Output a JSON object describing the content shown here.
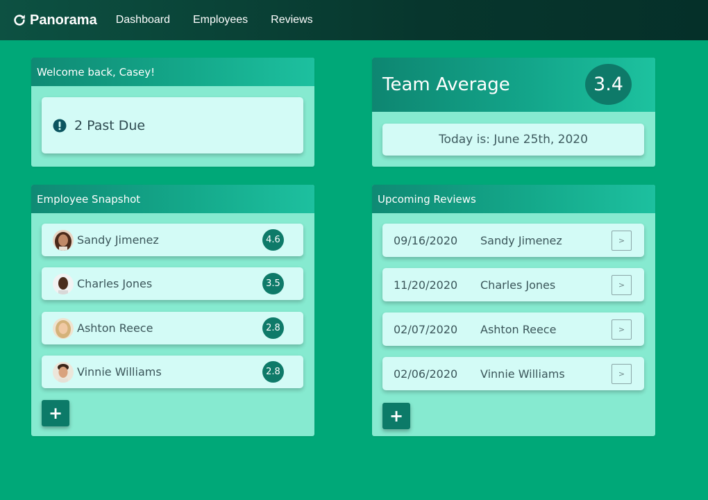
{
  "nav": {
    "brand": "Panorama",
    "links": [
      "Dashboard",
      "Employees",
      "Reviews"
    ]
  },
  "welcome": {
    "title": "Welcome back, Casey!",
    "past_due": "2 Past Due"
  },
  "team": {
    "title": "Team Average",
    "average": "3.4",
    "today": "Today is: June 25th, 2020"
  },
  "snapshot": {
    "title": "Employee Snapshot",
    "employees": [
      {
        "name": "Sandy Jimenez",
        "rating": "4.6"
      },
      {
        "name": "Charles Jones",
        "rating": "3.5"
      },
      {
        "name": "Ashton Reece",
        "rating": "2.8"
      },
      {
        "name": "Vinnie Williams",
        "rating": "2.8"
      }
    ],
    "add_label": "+"
  },
  "reviews": {
    "title": "Upcoming Reviews",
    "items": [
      {
        "date": "09/16/2020",
        "name": "Sandy Jimenez",
        "action": ">"
      },
      {
        "date": "11/20/2020",
        "name": "Charles Jones",
        "action": ">"
      },
      {
        "date": "02/07/2020",
        "name": "Ashton Reece",
        "action": ">"
      },
      {
        "date": "02/06/2020",
        "name": "Vinnie Williams",
        "action": ">"
      }
    ],
    "add_label": "+"
  },
  "icons": {
    "brand": "refresh-icon",
    "alert": "exclamation-circle-icon"
  },
  "colors": {
    "background": "#00a878",
    "navbar": "#07362d",
    "panel": "#86ead0",
    "card": "#d3fbf6",
    "badge": "#0e7a69"
  }
}
